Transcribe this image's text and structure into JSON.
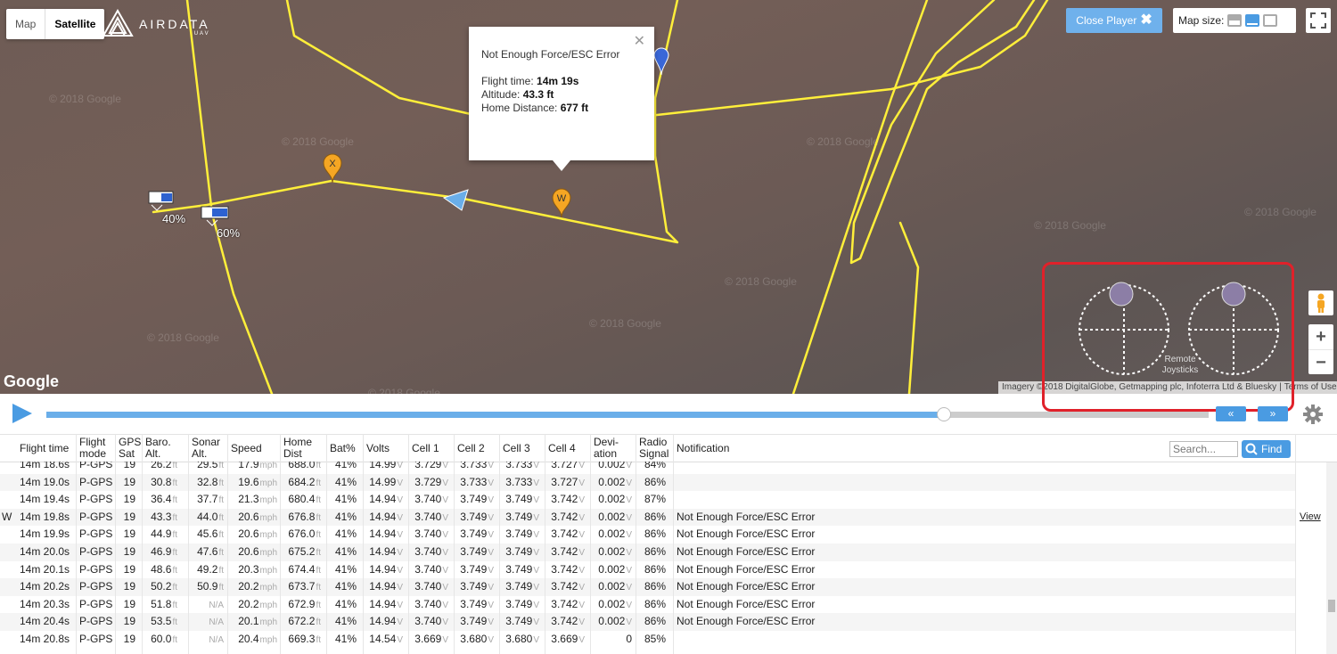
{
  "map": {
    "type_map": "Map",
    "type_satellite": "Satellite",
    "brand_name": "AIRDATA",
    "brand_sub": "UAV",
    "close_player": "Close Player",
    "map_size_label": "Map size:",
    "watermark": "© 2018 Google",
    "google_logo": "Google",
    "attribution": "Imagery ©2018 DigitalGlobe, Getmapping plc, Infoterra Ltd & Bluesky",
    "terms": "Terms of Use",
    "battery_labels": [
      "40%",
      "60%"
    ],
    "marker_x": "X",
    "marker_w": "W",
    "joystick_label": "Remote Joysticks",
    "colors": {
      "path": "#ffef3a",
      "marker": "#f5a623",
      "accent": "#4a9be2",
      "highlight": "#e0212a"
    }
  },
  "popup": {
    "title": "Not Enough Force/ESC Error",
    "flight_time_label": "Flight time:",
    "flight_time": "14m 19s",
    "altitude_label": "Altitude:",
    "altitude": "43.3 ft",
    "home_label": "Home Distance:",
    "home": "677 ft"
  },
  "player": {
    "progress": 0.775,
    "back_icon": "«",
    "fwd_icon": "»"
  },
  "table": {
    "columns": [
      {
        "key": "time",
        "l1": "Flight time"
      },
      {
        "key": "mode",
        "l1": "Flight",
        "l2": "mode"
      },
      {
        "key": "gps",
        "l1": "GPS",
        "l2": "Sat"
      },
      {
        "key": "baro",
        "l1": "Baro.",
        "l2": "Alt."
      },
      {
        "key": "sonar",
        "l1": "Sonar",
        "l2": "Alt."
      },
      {
        "key": "speed",
        "l1": "Speed"
      },
      {
        "key": "home",
        "l1": "Home",
        "l2": "Dist"
      },
      {
        "key": "bat",
        "l1": "Bat%"
      },
      {
        "key": "volts",
        "l1": "Volts"
      },
      {
        "key": "c1",
        "l1": "Cell 1"
      },
      {
        "key": "c2",
        "l1": "Cell 2"
      },
      {
        "key": "c3",
        "l1": "Cell 3"
      },
      {
        "key": "c4",
        "l1": "Cell 4"
      },
      {
        "key": "dev",
        "l1": "Devi-",
        "l2": "ation"
      },
      {
        "key": "radio",
        "l1": "Radio",
        "l2": "Signal"
      },
      {
        "key": "note",
        "l1": "Notification"
      }
    ],
    "search_placeholder": "Search...",
    "find_label": "Find",
    "units": {
      "ft": "ft",
      "mph": "mph",
      "v": "V"
    },
    "na": "N/A",
    "view_label": "View",
    "rows": [
      {
        "time": "14m 18.6s",
        "mode": "P-GPS",
        "gps": "19",
        "baro": "26.2",
        "sonar": "29.5",
        "speed": "17.9",
        "home": "688.0",
        "bat": "41%",
        "volts": "14.99",
        "c1": "3.729",
        "c2": "3.733",
        "c3": "3.733",
        "c4": "3.727",
        "dev": "0.002",
        "radio": "84%",
        "note": ""
      },
      {
        "time": "14m 19.0s",
        "mode": "P-GPS",
        "gps": "19",
        "baro": "30.8",
        "sonar": "32.8",
        "speed": "19.6",
        "home": "684.2",
        "bat": "41%",
        "volts": "14.99",
        "c1": "3.729",
        "c2": "3.733",
        "c3": "3.733",
        "c4": "3.727",
        "dev": "0.002",
        "radio": "86%",
        "note": ""
      },
      {
        "time": "14m 19.4s",
        "mode": "P-GPS",
        "gps": "19",
        "baro": "36.4",
        "sonar": "37.7",
        "speed": "21.3",
        "home": "680.4",
        "bat": "41%",
        "volts": "14.94",
        "c1": "3.740",
        "c2": "3.749",
        "c3": "3.749",
        "c4": "3.742",
        "dev": "0.002",
        "radio": "87%",
        "note": ""
      },
      {
        "marker": "W",
        "time": "14m 19.8s",
        "mode": "P-GPS",
        "gps": "19",
        "baro": "43.3",
        "sonar": "44.0",
        "speed": "20.6",
        "home": "676.8",
        "bat": "41%",
        "volts": "14.94",
        "c1": "3.740",
        "c2": "3.749",
        "c3": "3.749",
        "c4": "3.742",
        "dev": "0.002",
        "radio": "86%",
        "note": "Not Enough Force/ESC Error",
        "view": true
      },
      {
        "time": "14m 19.9s",
        "mode": "P-GPS",
        "gps": "19",
        "baro": "44.9",
        "sonar": "45.6",
        "speed": "20.6",
        "home": "676.0",
        "bat": "41%",
        "volts": "14.94",
        "c1": "3.740",
        "c2": "3.749",
        "c3": "3.749",
        "c4": "3.742",
        "dev": "0.002",
        "radio": "86%",
        "note": "Not Enough Force/ESC Error"
      },
      {
        "time": "14m 20.0s",
        "mode": "P-GPS",
        "gps": "19",
        "baro": "46.9",
        "sonar": "47.6",
        "speed": "20.6",
        "home": "675.2",
        "bat": "41%",
        "volts": "14.94",
        "c1": "3.740",
        "c2": "3.749",
        "c3": "3.749",
        "c4": "3.742",
        "dev": "0.002",
        "radio": "86%",
        "note": "Not Enough Force/ESC Error"
      },
      {
        "time": "14m 20.1s",
        "mode": "P-GPS",
        "gps": "19",
        "baro": "48.6",
        "sonar": "49.2",
        "speed": "20.3",
        "home": "674.4",
        "bat": "41%",
        "volts": "14.94",
        "c1": "3.740",
        "c2": "3.749",
        "c3": "3.749",
        "c4": "3.742",
        "dev": "0.002",
        "radio": "86%",
        "note": "Not Enough Force/ESC Error"
      },
      {
        "time": "14m 20.2s",
        "mode": "P-GPS",
        "gps": "19",
        "baro": "50.2",
        "sonar": "50.9",
        "speed": "20.2",
        "home": "673.7",
        "bat": "41%",
        "volts": "14.94",
        "c1": "3.740",
        "c2": "3.749",
        "c3": "3.749",
        "c4": "3.742",
        "dev": "0.002",
        "radio": "86%",
        "note": "Not Enough Force/ESC Error"
      },
      {
        "time": "14m 20.3s",
        "mode": "P-GPS",
        "gps": "19",
        "baro": "51.8",
        "sonar": "N/A",
        "speed": "20.2",
        "home": "672.9",
        "bat": "41%",
        "volts": "14.94",
        "c1": "3.740",
        "c2": "3.749",
        "c3": "3.749",
        "c4": "3.742",
        "dev": "0.002",
        "radio": "86%",
        "note": "Not Enough Force/ESC Error"
      },
      {
        "time": "14m 20.4s",
        "mode": "P-GPS",
        "gps": "19",
        "baro": "53.5",
        "sonar": "N/A",
        "speed": "20.1",
        "home": "672.2",
        "bat": "41%",
        "volts": "14.94",
        "c1": "3.740",
        "c2": "3.749",
        "c3": "3.749",
        "c4": "3.742",
        "dev": "0.002",
        "radio": "86%",
        "note": "Not Enough Force/ESC Error"
      },
      {
        "time": "14m 20.8s",
        "mode": "P-GPS",
        "gps": "19",
        "baro": "60.0",
        "sonar": "N/A",
        "speed": "20.4",
        "home": "669.3",
        "bat": "41%",
        "volts": "14.54",
        "c1": "3.669",
        "c2": "3.680",
        "c3": "3.680",
        "c4": "3.669",
        "dev": "0",
        "radio": "85%",
        "note": ""
      }
    ]
  }
}
